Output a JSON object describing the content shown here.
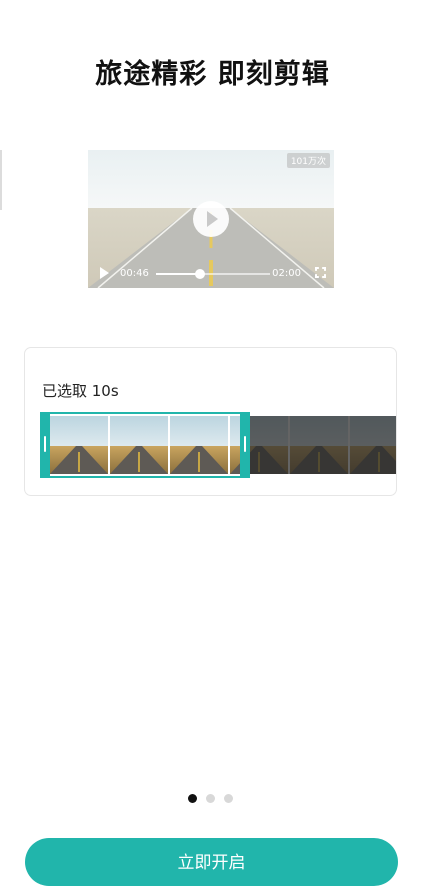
{
  "page": {
    "title": "旅途精彩 即刻剪辑"
  },
  "video": {
    "views_badge": "101万次",
    "current_time": "00:46",
    "total_time": "02:00",
    "progress_fraction": 0.383,
    "play_icon": "play-icon",
    "fullscreen_icon": "fullscreen-icon"
  },
  "selection": {
    "label": "已选取 10s",
    "accent_color": "#21b5ab"
  },
  "pager": {
    "count": 3,
    "active_index": 0
  },
  "footer": {
    "start_label": "立即开启"
  }
}
